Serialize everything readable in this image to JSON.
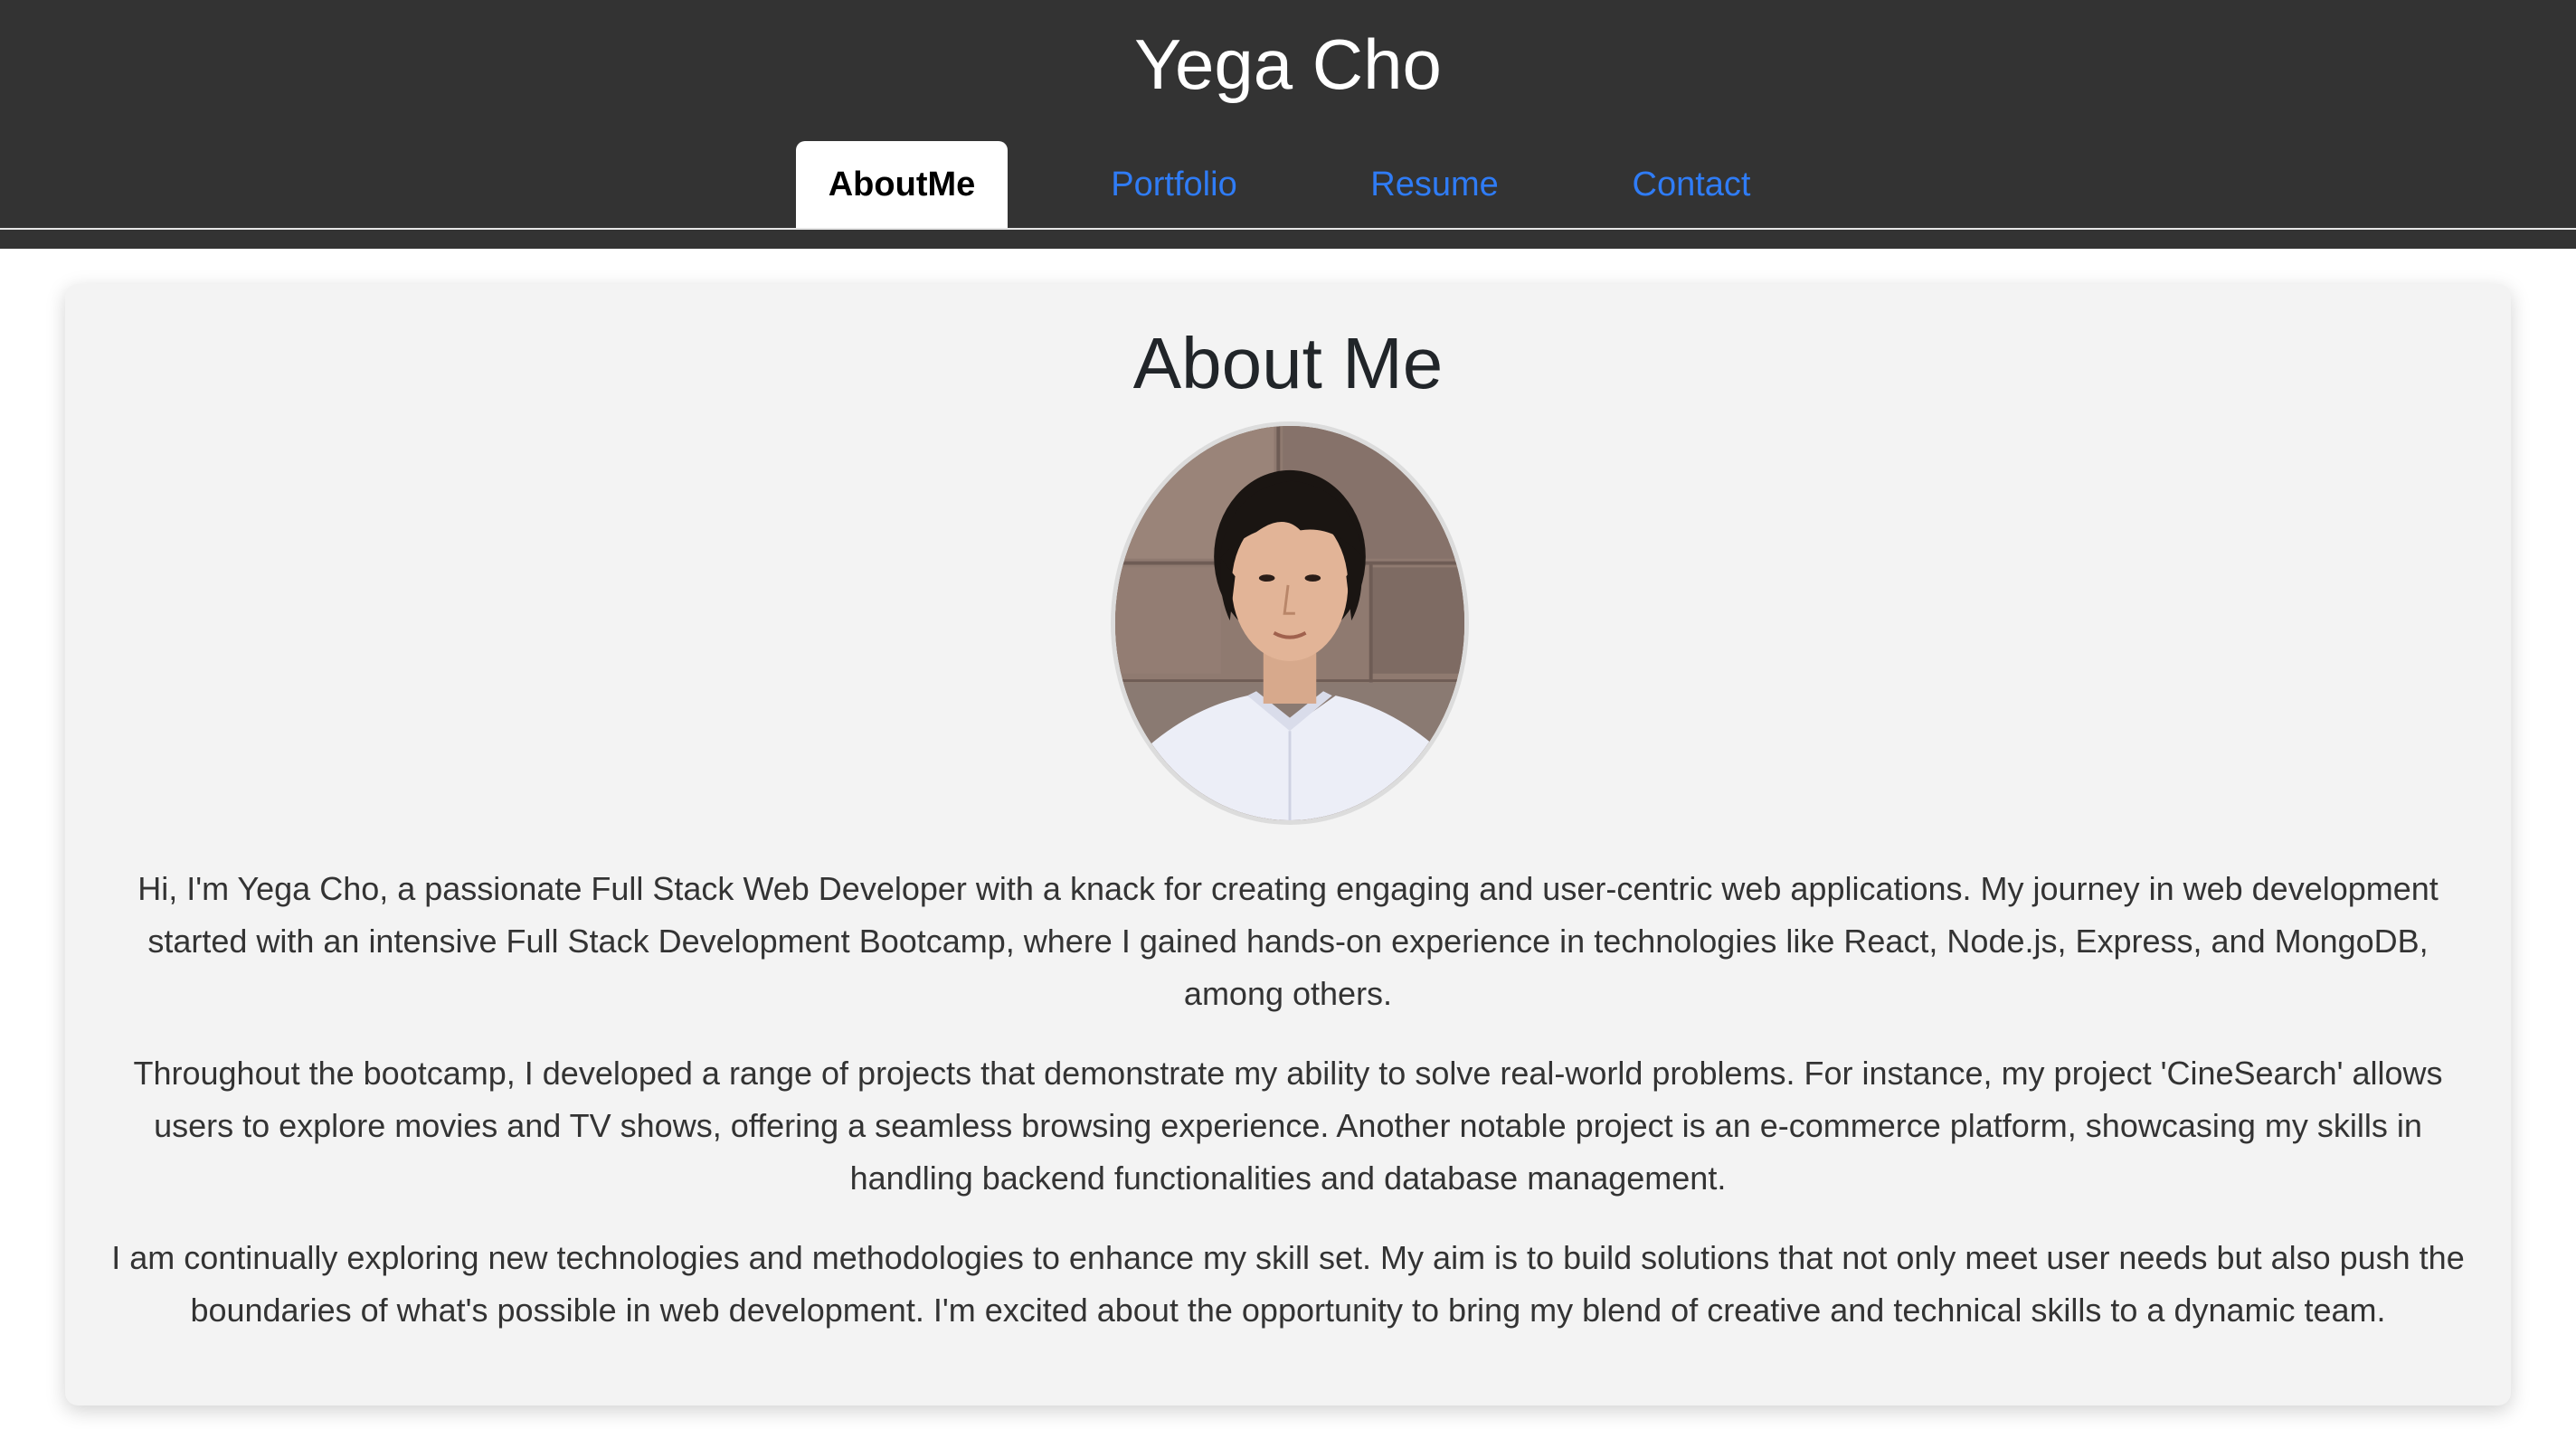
{
  "header": {
    "site_title": "Yega Cho"
  },
  "nav": {
    "tabs": [
      {
        "label": "AboutMe",
        "active": true
      },
      {
        "label": "Portfolio",
        "active": false
      },
      {
        "label": "Resume",
        "active": false
      },
      {
        "label": "Contact",
        "active": false
      }
    ]
  },
  "about": {
    "title": "About Me",
    "paragraphs": [
      "Hi, I'm Yega Cho, a passionate Full Stack Web Developer with a knack for creating engaging and user-centric web applications. My journey in web development started with an intensive Full Stack Development Bootcamp, where I gained hands-on experience in technologies like React, Node.js, Express, and MongoDB, among others.",
      "Throughout the bootcamp, I developed a range of projects that demonstrate my ability to solve real-world problems. For instance, my project 'CineSearch' allows users to explore movies and TV shows, offering a seamless browsing experience. Another notable project is an e-commerce platform, showcasing my skills in handling backend functionalities and database management.",
      "I am continually exploring new technologies and methodologies to enhance my skill set. My aim is to build solutions that not only meet user needs but also push the boundaries of what's possible in web development. I'm excited about the opportunity to bring my blend of creative and technical skills to a dynamic team."
    ]
  },
  "colors": {
    "header_bg": "#333333",
    "link": "#2f7cf6",
    "card_bg": "#f3f3f3"
  }
}
